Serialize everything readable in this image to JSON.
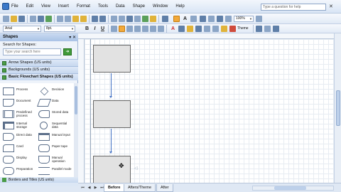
{
  "menu": {
    "items": [
      "File",
      "Edit",
      "View",
      "Insert",
      "Format",
      "Tools",
      "Data",
      "Shape",
      "Window",
      "Help"
    ],
    "help_placeholder": "Type a question for help"
  },
  "toolbar": {
    "zoom": "100%",
    "font": "Arial",
    "font_size": "8pt.",
    "theme_label": "Theme"
  },
  "shapes_panel": {
    "title": "Shapes",
    "search_label": "Search for Shapes:",
    "search_placeholder": "Type your search here",
    "stencils": [
      "Arrow Shapes (US units)",
      "Backgrounds (US units)",
      "Basic Flowchart Shapes (US units)"
    ],
    "shapes": [
      {
        "label": "Process",
        "icon": "process-shape-icon"
      },
      {
        "label": "Decision",
        "icon": "decision-shape-icon"
      },
      {
        "label": "Document",
        "icon": "document-shape-icon"
      },
      {
        "label": "Data",
        "icon": "data-shape-icon"
      },
      {
        "label": "Predefined process",
        "icon": "predefined-process-icon"
      },
      {
        "label": "Stored data",
        "icon": "stored-data-icon"
      },
      {
        "label": "Internal storage",
        "icon": "internal-storage-icon"
      },
      {
        "label": "Sequential data",
        "icon": "sequential-data-icon"
      },
      {
        "label": "Direct data",
        "icon": "direct-data-icon"
      },
      {
        "label": "Manual input",
        "icon": "manual-input-icon"
      },
      {
        "label": "Card",
        "icon": "card-shape-icon"
      },
      {
        "label": "Paper tape",
        "icon": "paper-tape-icon"
      },
      {
        "label": "Display",
        "icon": "display-shape-icon"
      },
      {
        "label": "Manual operation",
        "icon": "manual-operation-icon"
      },
      {
        "label": "Preparation",
        "icon": "preparation-shape-icon"
      },
      {
        "label": "Parallel mode",
        "icon": "parallel-mode-icon"
      }
    ],
    "bottom_stencil": "Borders and Titles (US units)"
  },
  "pages": {
    "tabs": [
      "Before",
      "Afters/Theme",
      "After"
    ],
    "active": "Before"
  },
  "colors": {
    "accent": "#3a78c9",
    "connector": "#4472c4",
    "shape_fill": "#e2e2e2",
    "stencil_icon": "#4a9b47"
  }
}
